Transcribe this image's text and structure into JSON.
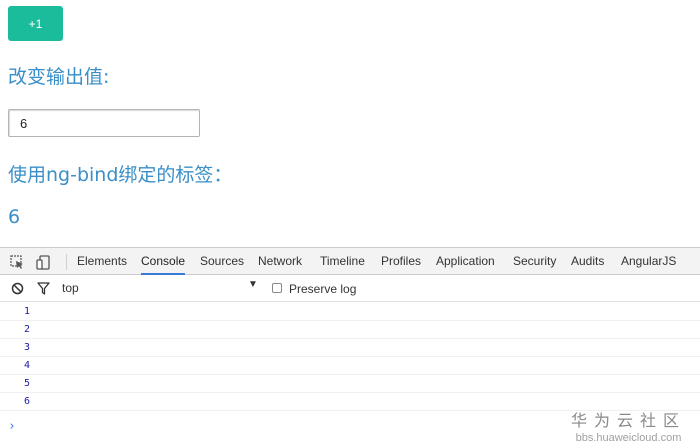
{
  "page": {
    "plus_button": "+1",
    "change_label": "改变输出值:",
    "input_value": "6",
    "bind_label": "使用ng-bind绑定的标签：",
    "bound_value": "6"
  },
  "devtools": {
    "tabs": [
      "Elements",
      "Console",
      "Sources",
      "Network",
      "Timeline",
      "Profiles",
      "Application",
      "Security",
      "Audits",
      "AngularJS"
    ],
    "active_tab": "Console",
    "context": "top",
    "preserve_log": "Preserve log",
    "console_lines": [
      "1",
      "2",
      "3",
      "4",
      "5",
      "6"
    ],
    "prompt": "›"
  },
  "watermark": {
    "title": "华为云社区",
    "url": "bbs.huaweicloud.com"
  },
  "colors": {
    "button": "#1abc9c",
    "label": "#3a8fc8",
    "active_tab_underline": "#3879d9",
    "console_text": "#1a1aa6"
  },
  "icons": [
    "inspect-icon",
    "device-icon",
    "clear-console-icon",
    "filter-icon",
    "dropdown-arrow-icon"
  ]
}
